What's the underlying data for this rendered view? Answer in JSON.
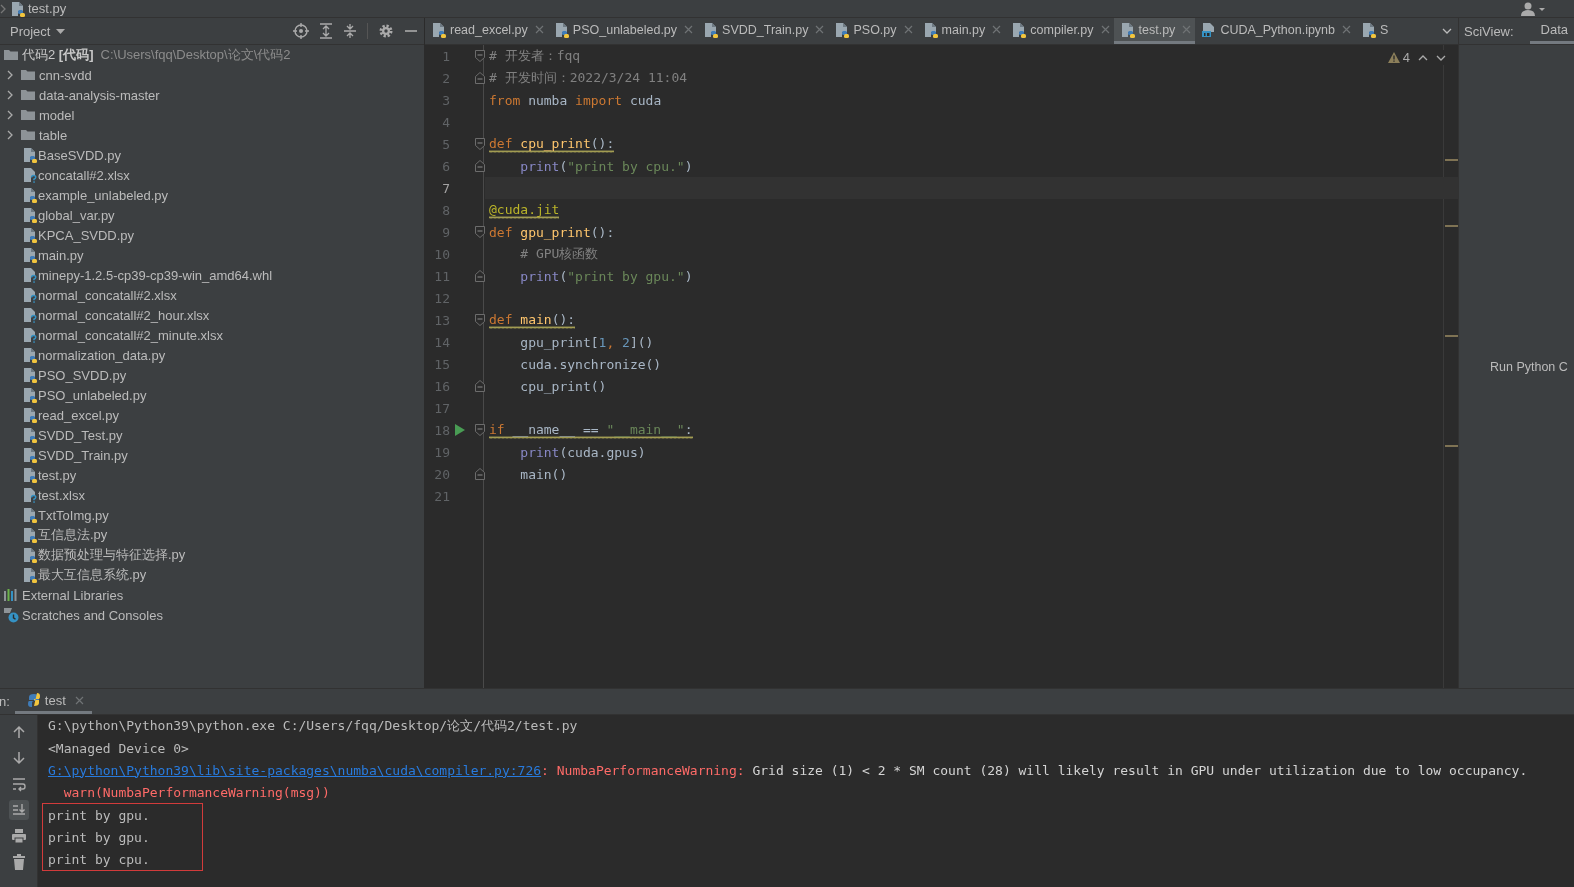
{
  "breadcrumb": {
    "file": "test.py"
  },
  "project_panel": {
    "title": "Project",
    "tree": [
      {
        "kind": "root",
        "name": "代码2 **[代码]**",
        "path": "C:\\Users\\fqq\\Desktop\\论文\\代码2",
        "children": [
          {
            "kind": "folder",
            "name": "cnn-svdd",
            "expanded": false
          },
          {
            "kind": "folder",
            "name": "data-analysis-master",
            "expanded": false
          },
          {
            "kind": "folder",
            "name": "model",
            "expanded": false
          },
          {
            "kind": "folder",
            "name": "table",
            "expanded": false
          },
          {
            "kind": "python",
            "name": "BaseSVDD.py"
          },
          {
            "kind": "unknown",
            "name": "concatall#2.xlsx"
          },
          {
            "kind": "python",
            "name": "example_unlabeled.py"
          },
          {
            "kind": "python",
            "name": "global_var.py"
          },
          {
            "kind": "python",
            "name": "KPCA_SVDD.py"
          },
          {
            "kind": "python",
            "name": "main.py"
          },
          {
            "kind": "unknown",
            "name": "minepy-1.2.5-cp39-cp39-win_amd64.whl"
          },
          {
            "kind": "unknown",
            "name": "normal_concatall#2.xlsx"
          },
          {
            "kind": "unknown",
            "name": "normal_concatall#2_hour.xlsx"
          },
          {
            "kind": "unknown",
            "name": "normal_concatall#2_minute.xlsx"
          },
          {
            "kind": "python",
            "name": "normalization_data.py"
          },
          {
            "kind": "python",
            "name": "PSO_SVDD.py"
          },
          {
            "kind": "python",
            "name": "PSO_unlabeled.py"
          },
          {
            "kind": "python",
            "name": "read_excel.py"
          },
          {
            "kind": "python",
            "name": "SVDD_Test.py"
          },
          {
            "kind": "python",
            "name": "SVDD_Train.py"
          },
          {
            "kind": "python",
            "name": "test.py"
          },
          {
            "kind": "unknown",
            "name": "test.xlsx"
          },
          {
            "kind": "python",
            "name": "TxtToImg.py"
          },
          {
            "kind": "python",
            "name": "互信息法.py"
          },
          {
            "kind": "python",
            "name": "数据预处理与特征选择.py"
          },
          {
            "kind": "python",
            "name": "最大互信息系统.py"
          }
        ]
      },
      {
        "kind": "libraries",
        "name": "External Libraries"
      },
      {
        "kind": "scratches",
        "name": "Scratches and Consoles"
      }
    ]
  },
  "editor_tabs": [
    {
      "label": "read_excel.py",
      "kind": "python",
      "selected": false,
      "closable": true
    },
    {
      "label": "PSO_unlabeled.py",
      "kind": "python",
      "selected": false,
      "closable": true
    },
    {
      "label": "SVDD_Train.py",
      "kind": "python",
      "selected": false,
      "closable": true
    },
    {
      "label": "PSO.py",
      "kind": "python",
      "selected": false,
      "closable": true
    },
    {
      "label": "main.py",
      "kind": "python",
      "selected": false,
      "closable": true
    },
    {
      "label": "compiler.py",
      "kind": "python",
      "selected": false,
      "closable": true
    },
    {
      "label": "test.py",
      "kind": "python",
      "selected": true,
      "closable": true
    },
    {
      "label": "CUDA_Python.ipynb",
      "kind": "notebook",
      "selected": false,
      "closable": true
    },
    {
      "label": "S",
      "kind": "python",
      "selected": false,
      "closable": false
    }
  ],
  "sciview": {
    "label": "SciView:",
    "tabs": [
      {
        "label": "Data",
        "selected": true
      }
    ],
    "message": "Run Python C"
  },
  "editor": {
    "warning_count": "4",
    "lines": [
      {
        "number": "1",
        "current": false,
        "warned": false,
        "fold_start": true,
        "fold_end": false,
        "run_marker": false,
        "tokens": [
          {
            "kind": "comment",
            "text": "# 开发者：fqq"
          }
        ]
      },
      {
        "number": "2",
        "current": false,
        "warned": false,
        "fold_start": false,
        "fold_end": true,
        "run_marker": false,
        "tokens": [
          {
            "kind": "comment",
            "text": "# 开发时间：2022/3/24 11:04"
          }
        ]
      },
      {
        "number": "3",
        "current": false,
        "warned": false,
        "fold_start": false,
        "fold_end": false,
        "run_marker": false,
        "tokens": [
          {
            "kind": "keyword",
            "text": "from"
          },
          {
            "kind": "plain",
            "text": " numba "
          },
          {
            "kind": "keyword",
            "text": "import"
          },
          {
            "kind": "plain",
            "text": " cuda"
          }
        ]
      },
      {
        "number": "4",
        "current": false,
        "warned": false,
        "fold_start": false,
        "fold_end": false,
        "run_marker": false
      },
      {
        "number": "5",
        "current": false,
        "warned": true,
        "fold_start": true,
        "fold_end": false,
        "run_marker": false,
        "tokens": [
          {
            "kind": "keyword",
            "text": "def"
          },
          {
            "kind": "function",
            "text": " cpu_print"
          },
          {
            "kind": "plain",
            "text": "():"
          }
        ]
      },
      {
        "number": "6",
        "current": false,
        "warned": false,
        "fold_start": false,
        "fold_end": true,
        "run_marker": false,
        "tokens": [
          {
            "kind": "builtin",
            "text": "    print"
          },
          {
            "kind": "plain",
            "text": "("
          },
          {
            "kind": "string",
            "text": "\"print by cpu.\""
          },
          {
            "kind": "plain",
            "text": ")"
          }
        ]
      },
      {
        "number": "7",
        "current": true,
        "warned": false,
        "fold_start": false,
        "fold_end": false,
        "run_marker": false
      },
      {
        "number": "8",
        "current": false,
        "warned": true,
        "fold_start": false,
        "fold_end": false,
        "run_marker": false,
        "tokens": [
          {
            "kind": "decorator",
            "text": "@cuda.jit"
          }
        ]
      },
      {
        "number": "9",
        "current": false,
        "warned": false,
        "fold_start": true,
        "fold_end": false,
        "run_marker": false,
        "tokens": [
          {
            "kind": "keyword",
            "text": "def"
          },
          {
            "kind": "function",
            "text": " gpu_print"
          },
          {
            "kind": "plain",
            "text": "():"
          }
        ]
      },
      {
        "number": "10",
        "current": false,
        "warned": false,
        "fold_start": false,
        "fold_end": false,
        "run_marker": false,
        "tokens": [
          {
            "kind": "comment",
            "text": "    # GPU核函数"
          }
        ]
      },
      {
        "number": "11",
        "current": false,
        "warned": false,
        "fold_start": false,
        "fold_end": true,
        "run_marker": false,
        "tokens": [
          {
            "kind": "builtin",
            "text": "    print"
          },
          {
            "kind": "plain",
            "text": "("
          },
          {
            "kind": "string",
            "text": "\"print by gpu.\""
          },
          {
            "kind": "plain",
            "text": ")"
          }
        ]
      },
      {
        "number": "12",
        "current": false,
        "warned": false,
        "fold_start": false,
        "fold_end": false,
        "run_marker": false
      },
      {
        "number": "13",
        "current": false,
        "warned": true,
        "fold_start": true,
        "fold_end": false,
        "run_marker": false,
        "tokens": [
          {
            "kind": "keyword",
            "text": "def"
          },
          {
            "kind": "function",
            "text": " main"
          },
          {
            "kind": "plain",
            "text": "():"
          }
        ]
      },
      {
        "number": "14",
        "current": false,
        "warned": false,
        "fold_start": false,
        "fold_end": false,
        "run_marker": false,
        "tokens": [
          {
            "kind": "plain",
            "text": "    gpu_print["
          },
          {
            "kind": "number",
            "text": "1"
          },
          {
            "kind": "keyword",
            "text": ", "
          },
          {
            "kind": "number",
            "text": "2"
          },
          {
            "kind": "plain",
            "text": "]()"
          }
        ]
      },
      {
        "number": "15",
        "current": false,
        "warned": false,
        "fold_start": false,
        "fold_end": false,
        "run_marker": false,
        "tokens": [
          {
            "kind": "plain",
            "text": "    cuda.synchronize()"
          }
        ]
      },
      {
        "number": "16",
        "current": false,
        "warned": false,
        "fold_start": false,
        "fold_end": true,
        "run_marker": false,
        "tokens": [
          {
            "kind": "plain",
            "text": "    cpu_print()"
          }
        ]
      },
      {
        "number": "17",
        "current": false,
        "warned": false,
        "fold_start": false,
        "fold_end": false,
        "run_marker": false
      },
      {
        "number": "18",
        "current": false,
        "warned": true,
        "fold_start": true,
        "fold_end": false,
        "run_marker": true,
        "tokens": [
          {
            "kind": "keyword",
            "text": "if"
          },
          {
            "kind": "plain",
            "text": " __name__ == "
          },
          {
            "kind": "string",
            "text": "\"__main__\""
          },
          {
            "kind": "plain",
            "text": ":"
          }
        ]
      },
      {
        "number": "19",
        "current": false,
        "warned": false,
        "fold_start": false,
        "fold_end": false,
        "run_marker": false,
        "tokens": [
          {
            "kind": "builtin",
            "text": "    print"
          },
          {
            "kind": "plain",
            "text": "(cuda.gpus)"
          }
        ]
      },
      {
        "number": "20",
        "current": false,
        "warned": false,
        "fold_start": false,
        "fold_end": true,
        "run_marker": false,
        "tokens": [
          {
            "kind": "plain",
            "text": "    main()"
          }
        ]
      },
      {
        "number": "21",
        "current": false,
        "warned": false,
        "fold_start": false,
        "fold_end": false,
        "run_marker": false
      }
    ]
  },
  "run_panel": {
    "label": "n:",
    "tabs": [
      {
        "label": "test",
        "selected": true
      }
    ],
    "toolbar": [
      {
        "kind": "up",
        "active": false
      },
      {
        "kind": "down",
        "active": false
      },
      {
        "kind": "wrap",
        "active": false
      },
      {
        "kind": "scroll-end",
        "active": true
      },
      {
        "kind": "print",
        "active": false
      },
      {
        "kind": "delete",
        "active": false
      }
    ],
    "lines": [
      {
        "boxed": false,
        "segments": [
          {
            "kind": "plain",
            "text": "G:\\python\\Python39\\python.exe C:/Users/fqq/Desktop/论文/代码2/test.py"
          }
        ]
      },
      {
        "boxed": false,
        "segments": [
          {
            "kind": "plain",
            "text": "<Managed Device 0>"
          }
        ]
      },
      {
        "boxed": false,
        "segments": [
          {
            "kind": "link",
            "text": "G:\\python\\Python39\\lib\\site-packages\\numba\\cuda\\compiler.py:726"
          },
          {
            "kind": "error",
            "text": ": NumbaPerformanceWarning: "
          },
          {
            "kind": "bright",
            "text": "Grid size (1) < 2 * SM count (28) will likely result in GPU under utilization due to low occupancy."
          }
        ]
      },
      {
        "boxed": false,
        "segments": [
          {
            "kind": "error",
            "text": "  warn(NumbaPerformanceWarning(msg))"
          }
        ]
      },
      {
        "boxed": true,
        "segments": [
          {
            "kind": "plain",
            "text": "print by gpu."
          }
        ]
      },
      {
        "boxed": true,
        "segments": [
          {
            "kind": "plain",
            "text": "print by gpu."
          }
        ]
      },
      {
        "boxed": true,
        "segments": [
          {
            "kind": "plain",
            "text": "print by cpu."
          }
        ]
      }
    ]
  }
}
